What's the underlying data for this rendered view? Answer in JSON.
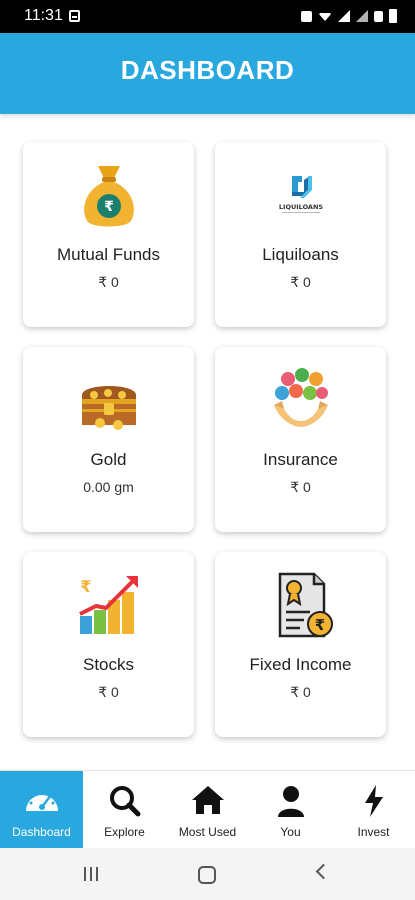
{
  "status_bar": {
    "time": "11:31"
  },
  "header": {
    "title": "DASHBOARD"
  },
  "cards": [
    {
      "title": "Mutual Funds",
      "value": "₹ 0",
      "icon": "money-bag-icon"
    },
    {
      "title": "Liquiloans",
      "value": "₹ 0",
      "icon": "liquiloans-logo",
      "logo_text": "LIQUILOANS"
    },
    {
      "title": "Gold",
      "value": "0.00 gm",
      "icon": "treasure-chest-icon"
    },
    {
      "title": "Insurance",
      "value": "₹ 0",
      "icon": "insurance-hands-icon"
    },
    {
      "title": "Stocks",
      "value": "₹ 0",
      "icon": "stocks-growth-chart-icon"
    },
    {
      "title": "Fixed Income",
      "value": "₹ 0",
      "icon": "certificate-rupee-icon"
    }
  ],
  "bottom_nav": [
    {
      "label": "Dashboard",
      "icon": "speedometer-icon",
      "active": true
    },
    {
      "label": "Explore",
      "icon": "search-icon",
      "active": false
    },
    {
      "label": "Most Used",
      "icon": "home-icon",
      "active": false
    },
    {
      "label": "You",
      "icon": "user-icon",
      "active": false
    },
    {
      "label": "Invest",
      "icon": "lightning-icon",
      "active": false
    }
  ],
  "colors": {
    "brand": "#29a8e0",
    "gold": "#f2b430"
  }
}
